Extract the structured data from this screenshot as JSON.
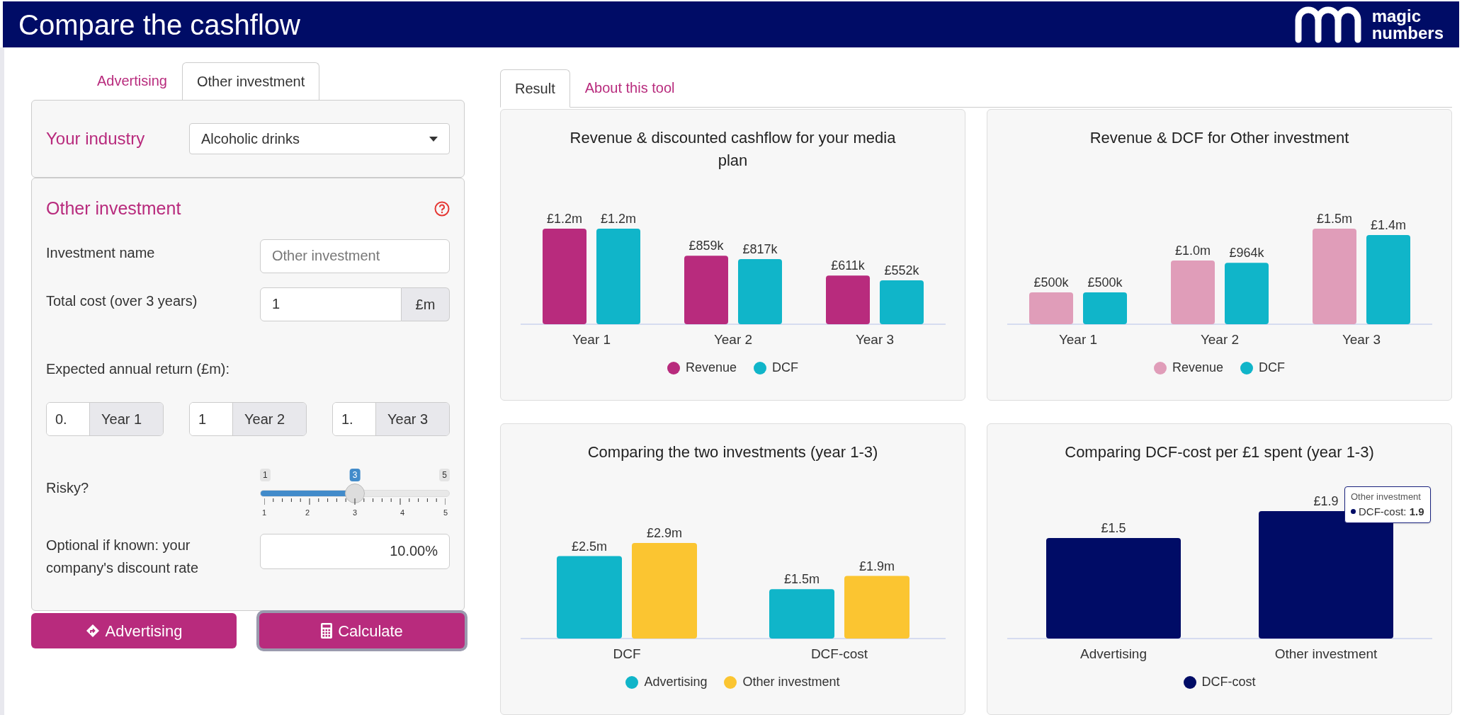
{
  "header": {
    "title": "Compare the cashflow",
    "logo_text": [
      "magic",
      "numbers"
    ]
  },
  "left_tabs": [
    {
      "label": "Advertising",
      "selected": false
    },
    {
      "label": "Other investment",
      "selected": true
    }
  ],
  "industry": {
    "label": "Your industry",
    "value": "Alcoholic drinks"
  },
  "investment": {
    "title": "Other investment",
    "name": {
      "label": "Investment name",
      "placeholder": "Other investment"
    },
    "cost": {
      "label": "Total cost (over 3 years)",
      "value": "1",
      "unit": "£m"
    },
    "returns_label": "Expected annual return (£m):",
    "returns": [
      {
        "value": "0.",
        "label": "Year 1"
      },
      {
        "value": "1",
        "label": "Year 2"
      },
      {
        "value": "1.",
        "label": "Year 3"
      }
    ],
    "risk": {
      "label": "Risky?",
      "min_label": "1",
      "value_label": "3",
      "max_label": "5",
      "ticks": [
        "1",
        "2",
        "3",
        "4",
        "5"
      ],
      "level": 0.5
    },
    "discount": {
      "label": "Optional if known: your company's discount rate",
      "value": "10.00%"
    }
  },
  "buttons": [
    {
      "label": "Advertising",
      "kind": "route",
      "focused": false
    },
    {
      "label": "Calculate",
      "kind": "calculator",
      "focused": true
    }
  ],
  "right_tabs": [
    {
      "label": "Result",
      "selected": true
    },
    {
      "label": "About this tool",
      "selected": false
    }
  ],
  "charts": [
    {
      "chart_data": {
        "type": "bar",
        "title": "Revenue & discounted cashflow for your media plan",
        "categories": [
          "Year 1",
          "Year 2",
          "Year 3"
        ],
        "data_labels": true,
        "series": [
          {
            "name": "Revenue",
            "color": "#b82b7d",
            "values": [
              1200000,
              859000,
              611000
            ],
            "value_labels": [
              "£1.2m",
              "£859k",
              "£611k"
            ]
          },
          {
            "name": "DCF",
            "color": "#10b5c9",
            "values": [
              1200000,
              817000,
              552000
            ],
            "value_labels": [
              "£1.2m",
              "£817k",
              "£552k"
            ]
          }
        ]
      }
    },
    {
      "chart_data": {
        "type": "bar",
        "title": "Revenue & DCF for Other investment",
        "categories": [
          "Year 1",
          "Year 2",
          "Year 3"
        ],
        "data_labels": true,
        "series": [
          {
            "name": "Revenue",
            "color": "#e09db9",
            "values": [
              500000,
              1000000,
              1500000
            ],
            "value_labels": [
              "£500k",
              "£1.0m",
              "£1.5m"
            ]
          },
          {
            "name": "DCF",
            "color": "#10b5c9",
            "values": [
              500000,
              964000,
              1400000
            ],
            "value_labels": [
              "£500k",
              "£964k",
              "£1.4m"
            ]
          }
        ]
      }
    },
    {
      "chart_data": {
        "type": "bar",
        "title": "Comparing the two investments (year 1-3)",
        "categories": [
          "DCF",
          "DCF-cost"
        ],
        "data_labels": true,
        "series": [
          {
            "name": "Advertising",
            "color": "#10b5c9",
            "values": [
              2.5,
              1.5
            ],
            "value_labels": [
              "£2.5m",
              "£1.5m"
            ]
          },
          {
            "name": "Other investment",
            "color": "#fbc531",
            "values": [
              2.9,
              1.9
            ],
            "value_labels": [
              "£2.9m",
              "£1.9m"
            ]
          }
        ]
      }
    },
    {
      "chart_data": {
        "type": "bar",
        "title": "Comparing DCF-cost per £1 spent (year 1-3)",
        "categories": [
          "Advertising",
          "Other investment"
        ],
        "data_labels": true,
        "series": [
          {
            "name": "DCF-cost",
            "color": "#000c66",
            "values": [
              1.5,
              1.9
            ],
            "value_labels": [
              "£1.5",
              "£1.9"
            ]
          }
        ]
      },
      "tooltip": {
        "title": "Other investment",
        "label": "DCF-cost: ",
        "value": "1.9"
      }
    }
  ]
}
